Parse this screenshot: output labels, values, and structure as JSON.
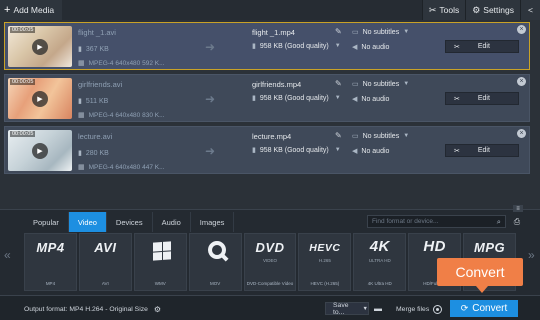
{
  "topbar": {
    "add_media_label": "Add Media",
    "tools_label": "Tools",
    "settings_label": "Settings"
  },
  "files": [
    {
      "duration": "00:00:05",
      "source_name": "flight _1.avi",
      "source_size": "367 KB",
      "source_info": "MPEG-4 640x480 592 K...",
      "output_name": "flight _1.mp4",
      "output_size": "958 KB (Good quality)",
      "subtitles": "No subtitles",
      "audio": "No audio",
      "edit_label": "Edit",
      "selected": true
    },
    {
      "duration": "00:00:05",
      "source_name": "girlfriends.avi",
      "source_size": "511 KB",
      "source_info": "MPEG-4 640x480 830 K...",
      "output_name": "girlfriends.mp4",
      "output_size": "958 KB (Good quality)",
      "subtitles": "No subtitles",
      "audio": "No audio",
      "edit_label": "Edit",
      "selected": false
    },
    {
      "duration": "00:00:05",
      "source_name": "lecture.avi",
      "source_size": "280 KB",
      "source_info": "MPEG-4 640x480 447 K...",
      "output_name": "lecture.mp4",
      "output_size": "958 KB (Good quality)",
      "subtitles": "No subtitles",
      "audio": "No audio",
      "edit_label": "Edit",
      "selected": false
    }
  ],
  "format_tabs": [
    "Popular",
    "Video",
    "Devices",
    "Audio",
    "Images"
  ],
  "active_tab": "Video",
  "search": {
    "placeholder": "Find format or device..."
  },
  "formats": [
    {
      "logo": "MP4",
      "caption": "MP4"
    },
    {
      "logo": "AVI",
      "caption": "AVI"
    },
    {
      "logo": "",
      "caption": "WMV",
      "icon": "windows-icon"
    },
    {
      "logo": "",
      "caption": "MOV",
      "icon": "quicktime-icon"
    },
    {
      "logo": "DVD",
      "logo_sub": "VIDEO",
      "caption": "DVD-Compatible Video"
    },
    {
      "logo": "HEVC",
      "logo_sub": "H.265",
      "caption": "HEVC (H.265)"
    },
    {
      "logo": "4K",
      "logo_sub": "ULTRA HD",
      "caption": "4K Ultra HD"
    },
    {
      "logo": "HD",
      "caption": "HD/Full HD"
    },
    {
      "logo": "MPG",
      "caption": "MPEG-1"
    }
  ],
  "bottombar": {
    "output_format": "Output format: MP4 H.264 - Original Size",
    "save_to_label": "Save to...",
    "merge_label": "Merge files",
    "convert_label": "Convert"
  },
  "callout": {
    "label": "Convert"
  },
  "colors": {
    "accent_blue": "#1d8fe1",
    "callout_orange": "#f07f47",
    "selected_border": "#c9a227"
  }
}
